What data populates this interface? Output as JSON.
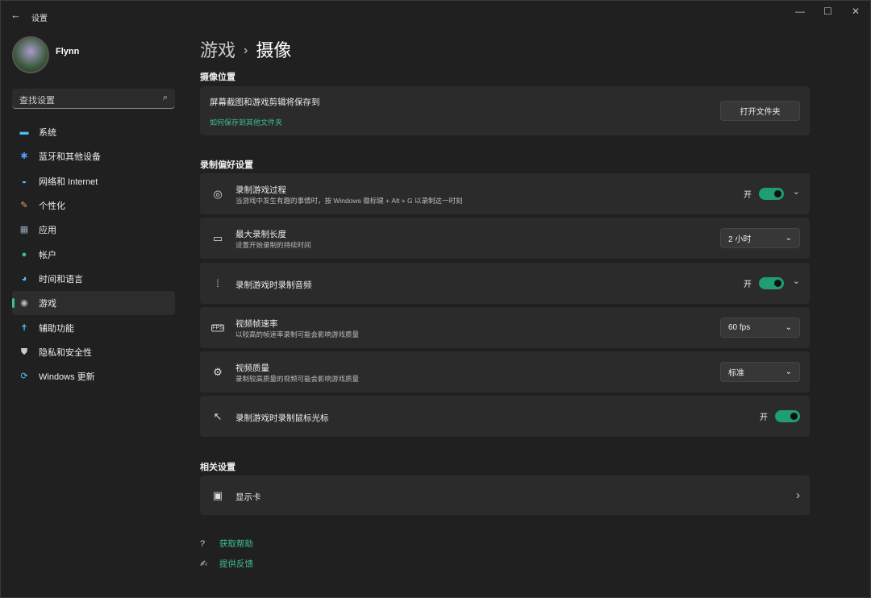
{
  "window": {
    "title": "设置",
    "back_icon": "←",
    "minimize": "—",
    "maximize": "☐",
    "close": "✕"
  },
  "user": {
    "name": "Flynn"
  },
  "search": {
    "placeholder": "查找设置",
    "icon": "⌕"
  },
  "nav": [
    {
      "label": "系统",
      "icon": "▬",
      "color": "#4cc2ff"
    },
    {
      "label": "蓝牙和其他设备",
      "icon": "✱",
      "color": "#4c9fff"
    },
    {
      "label": "网络和 Internet",
      "icon": "◒",
      "color": "#4cc2ff"
    },
    {
      "label": "个性化",
      "icon": "✎",
      "color": "#e8a25a"
    },
    {
      "label": "应用",
      "icon": "▦",
      "color": "#9ab"
    },
    {
      "label": "帐户",
      "icon": "●",
      "color": "#3fbf8f"
    },
    {
      "label": "时间和语言",
      "icon": "◕",
      "color": "#4cc2ff"
    },
    {
      "label": "游戏",
      "icon": "◉",
      "color": "#bbb"
    },
    {
      "label": "辅助功能",
      "icon": "✝",
      "color": "#4cc2ff"
    },
    {
      "label": "隐私和安全性",
      "icon": "⛊",
      "color": "#ccc"
    },
    {
      "label": "Windows 更新",
      "icon": "⟳",
      "color": "#4cc2ff"
    }
  ],
  "breadcrumb": {
    "parent": "游戏",
    "sep": "›",
    "current": "摄像"
  },
  "capture_location": {
    "heading": "摄像位置",
    "title": "屏幕截图和游戏剪辑将保存到",
    "link": "如何保存到其他文件夹",
    "button": "打开文件夹"
  },
  "prefs": {
    "heading": "录制偏好设置",
    "rows": [
      {
        "icon": "◎",
        "title": "录制游戏过程",
        "desc": "当游戏中发生有趣的事情时，按 Windows 徽标键 + Alt + G 以录制这一时刻",
        "toggle": "开",
        "chevron": "⌄"
      },
      {
        "icon": "▭",
        "title": "最大录制长度",
        "desc": "设置开始录制的持续时间",
        "select": "2 小时",
        "chevron": "⌄"
      },
      {
        "icon": "⦙",
        "title": "录制游戏时录制音频",
        "toggle": "开",
        "chevron": "⌄"
      },
      {
        "icon": "FPS",
        "title": "视频帧速率",
        "desc": "以较高的帧速率录制可能会影响游戏质量",
        "select": "60 fps",
        "chevron": "⌄"
      },
      {
        "icon": "⚙",
        "title": "视频质量",
        "desc": "录制较高质量的视频可能会影响游戏质量",
        "select": "标准",
        "chevron": "⌄"
      },
      {
        "icon": "↖",
        "title": "录制游戏时录制鼠标光标",
        "toggle": "开"
      }
    ]
  },
  "related": {
    "heading": "相关设置",
    "item": "显示卡",
    "icon": "▣",
    "chevron": "›"
  },
  "footer": {
    "help": "获取帮助",
    "feedback": "提供反馈",
    "help_icon": "?",
    "feedback_icon": "✍"
  }
}
